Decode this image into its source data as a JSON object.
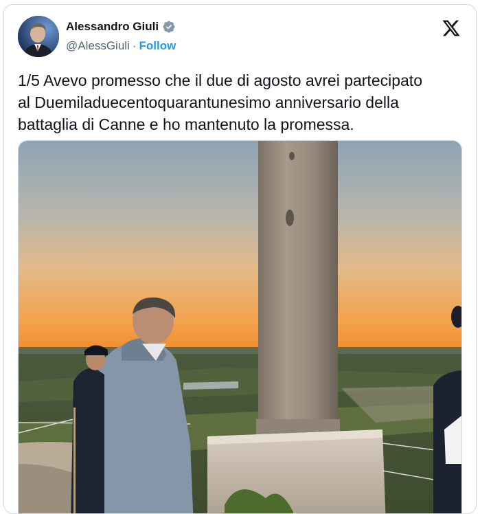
{
  "author": {
    "name": "Alessandro Giuli",
    "handle": "@AlessGiuli",
    "separator": "·",
    "follow_label": "Follow",
    "verified_icon": "verified-badge-icon"
  },
  "platform_logo": "x-logo-icon",
  "tweet": {
    "text": "1/5 Avevo promesso che il due di agosto avrei partecipato\nal Duemiladuecentoquarantunesimo anniversario della\nbattaglia di Canne e ho mantenuto la promessa."
  },
  "colors": {
    "accent": "#1d9bf0",
    "text_primary": "#0f1419",
    "text_secondary": "#536471",
    "border": "#cfd9de"
  }
}
